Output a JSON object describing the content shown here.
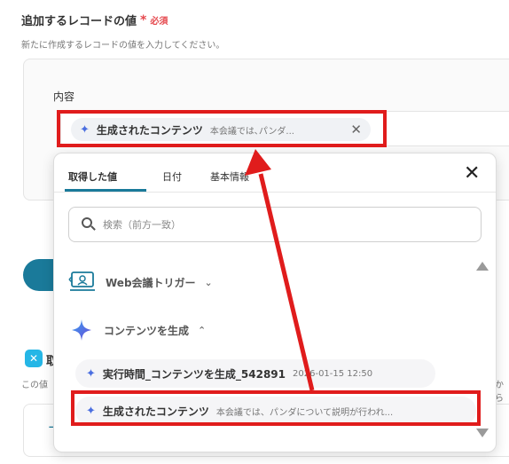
{
  "section": {
    "title": "追加するレコードの値",
    "required_star": "*",
    "required_label": "必須",
    "description": "新たに作成するレコードの値を入力してください。"
  },
  "field": {
    "label": "内容",
    "chip_name": "生成されたコンテンツ",
    "chip_preview": "本会議では､パンダ...",
    "chip_remove": "✕"
  },
  "dropdown": {
    "tabs": [
      {
        "label": "取得した値"
      },
      {
        "label": "日付"
      },
      {
        "label": "基本情報"
      }
    ],
    "close": "✕",
    "search_placeholder": "検索（前方一致）",
    "groups": [
      {
        "label": "Web会議トリガー",
        "chevron": "⌄",
        "icon": "video-meeting-icon"
      },
      {
        "label": "コンテンツを生成",
        "chevron": "⌃",
        "icon": "sparkle-icon"
      }
    ],
    "items": [
      {
        "name": "実行時間_コンテンツを生成_542891",
        "preview": "2026-01-15 12:50"
      },
      {
        "name": "生成されたコンテンツ",
        "preview": "本会議では、パンダについて説明が行われ..."
      }
    ]
  },
  "below": {
    "section2_title": "取",
    "section2_desc": "この値",
    "section2_desc_right": "から",
    "card_glyph": "ー"
  },
  "colors": {
    "highlight": "#e01c1c",
    "accent": "#1a7a9a",
    "required": "#e5484d",
    "sparkle": "#4a6ee0"
  }
}
